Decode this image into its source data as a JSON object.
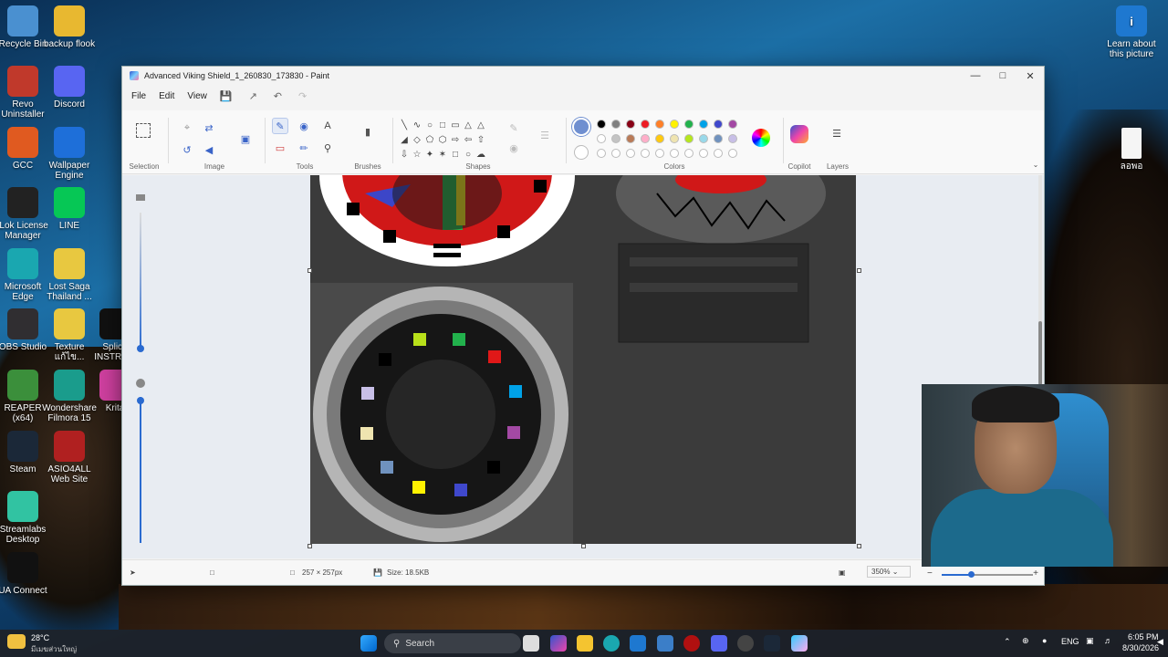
{
  "desktop": {
    "icons": [
      {
        "label": "Recycle Bin",
        "color": "#4a90d0"
      },
      {
        "label": "backup flook",
        "color": "#e8b830"
      },
      {
        "label": "Revo Uninstaller",
        "color": "#c0392b"
      },
      {
        "label": "Discord",
        "color": "#5865f2"
      },
      {
        "label": "GCC",
        "color": "#e05a20"
      },
      {
        "label": "Wallpaper Engine",
        "color": "#1e6fd9"
      },
      {
        "label": "iLok License Manager",
        "color": "#222222"
      },
      {
        "label": "LINE",
        "color": "#06c755"
      },
      {
        "label": "Microsoft Edge",
        "color": "#1aa7b0"
      },
      {
        "label": "Lost Saga Thailand ...",
        "color": "#e8c840"
      },
      {
        "label": "OBS Studio",
        "color": "#302e31"
      },
      {
        "label": "Texture แก้ไข...",
        "color": "#e8c840"
      },
      {
        "label": "Splice INSTRU...",
        "color": "#111111"
      },
      {
        "label": "REAPER (x64)",
        "color": "#3b8f3b"
      },
      {
        "label": "Wondershare Filmora 15",
        "color": "#1a9c8c"
      },
      {
        "label": "Krita",
        "color": "#d040a0"
      },
      {
        "label": "Steam",
        "color": "#1b2838"
      },
      {
        "label": "ASIO4ALL Web Site",
        "color": "#b02020"
      },
      {
        "label": "Streamlabs Desktop",
        "color": "#31c3a2"
      },
      {
        "label": "UA Connect",
        "color": "#111111"
      }
    ],
    "right_icons": [
      {
        "label": "Learn about this picture"
      },
      {
        "label": "ลอพอ"
      }
    ]
  },
  "window": {
    "title": "Advanced Viking Shield_1_260830_173830 - Paint",
    "menu": [
      "File",
      "Edit",
      "View"
    ],
    "groups": {
      "selection": "Selection",
      "image": "Image",
      "tools": "Tools",
      "brushes": "Brushes",
      "shapes": "Shapes",
      "colors": "Colors",
      "copilot": "Copilot",
      "layers": "Layers"
    },
    "palette_row1": [
      "#000000",
      "#7f7f7f",
      "#880015",
      "#ed1c24",
      "#ff7f27",
      "#fff200",
      "#22b14c",
      "#00a2e8",
      "#3f48cc",
      "#a349a4"
    ],
    "palette_row2": [
      "#ffffff",
      "#c3c3c3",
      "#b97a57",
      "#ffaec9",
      "#ffc90e",
      "#efe4b0",
      "#b5e61d",
      "#99d9ea",
      "#7092be",
      "#c8bfe7"
    ],
    "primary_color": "#6f8fd0",
    "status": {
      "dimensions": "257 × 257px",
      "size": "Size: 18.5KB",
      "zoom": "350%"
    }
  },
  "taskbar": {
    "weather_temp": "28°C",
    "weather_desc": "มีเมฆส่วนใหญ่",
    "search": "Search",
    "lang": "ENG",
    "time": "6:05 PM",
    "date": "8/30/2026"
  }
}
